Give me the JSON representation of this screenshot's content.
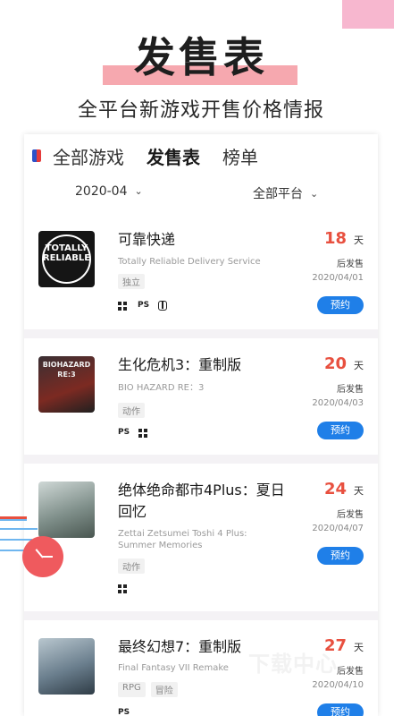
{
  "hero": {
    "title": "发售表",
    "subtitle": "全平台新游戏开售价格情报"
  },
  "tabs": {
    "items": [
      "全部游戏",
      "发售表",
      "榜单"
    ],
    "active_index": 1
  },
  "filters": {
    "month": "2020-04",
    "platform": "全部平台"
  },
  "games": [
    {
      "title": "可靠快递",
      "subtitle": "Totally Reliable Delivery Service",
      "tags": [
        "独立"
      ],
      "platforms": [
        "windows-icon",
        "playstation-icon",
        "switch-icon"
      ],
      "days": "18",
      "days_unit": "天",
      "after_label": "后发售",
      "date": "2020/04/01",
      "button": "预约",
      "cover_text": "TOTALLY RELIABLE"
    },
    {
      "title": "生化危机3：重制版",
      "subtitle": "BIO HAZARD RE：3",
      "tags": [
        "动作"
      ],
      "platforms": [
        "playstation-icon",
        "windows-icon"
      ],
      "days": "20",
      "days_unit": "天",
      "after_label": "后发售",
      "date": "2020/04/03",
      "button": "预约",
      "cover_text": "BIOHAZARD RE:3"
    },
    {
      "title": "绝体绝命都市4Plus：夏日回忆",
      "subtitle": "Zettai Zetsumei Toshi 4 Plus: Summer Memories",
      "tags": [
        "动作"
      ],
      "platforms": [
        "windows-icon"
      ],
      "days": "24",
      "days_unit": "天",
      "after_label": "后发售",
      "date": "2020/04/07",
      "button": "预约",
      "cover_text": ""
    },
    {
      "title": "最终幻想7：重制版",
      "subtitle": "Final Fantasy VII Remake",
      "tags": [
        "RPG",
        "冒险"
      ],
      "platforms": [
        "playstation-icon"
      ],
      "days": "27",
      "days_unit": "天",
      "after_label": "后发售",
      "date": "2020/04/10",
      "button": "预约",
      "cover_text": ""
    }
  ],
  "watermark": "下载中心"
}
